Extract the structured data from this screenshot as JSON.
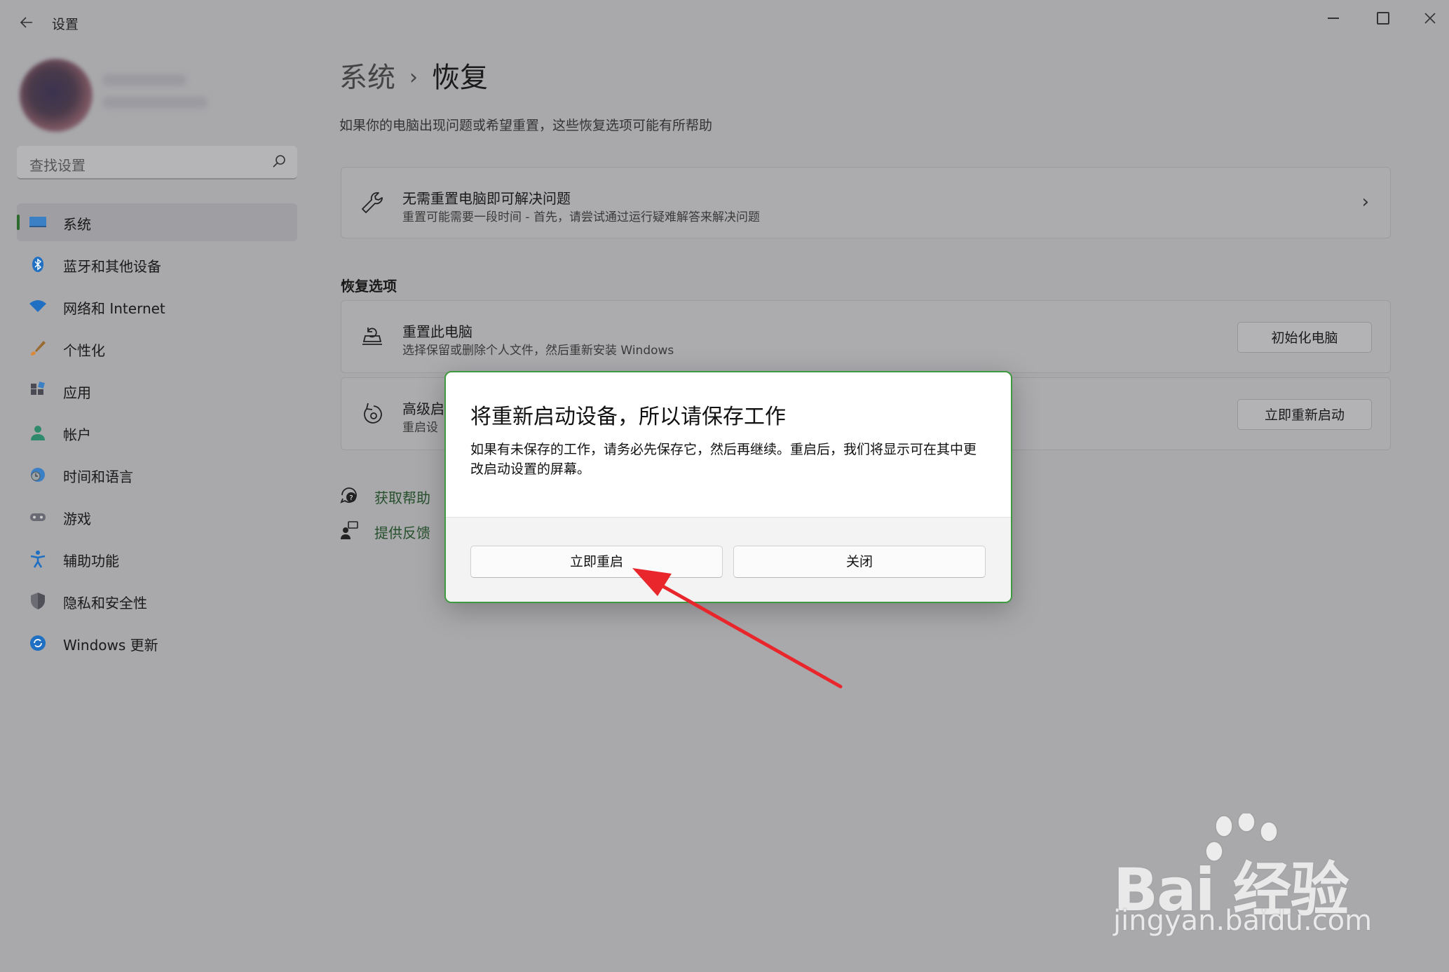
{
  "app": {
    "title": "设置",
    "back_icon": "back-arrow-icon"
  },
  "window_controls": [
    "minimize",
    "maximize",
    "close"
  ],
  "search": {
    "placeholder": "查找设置"
  },
  "nav": [
    {
      "label": "系统",
      "icon": "monitor-icon",
      "active": true
    },
    {
      "label": "蓝牙和其他设备",
      "icon": "bluetooth-icon"
    },
    {
      "label": "网络和 Internet",
      "icon": "wifi-icon"
    },
    {
      "label": "个性化",
      "icon": "brush-icon"
    },
    {
      "label": "应用",
      "icon": "apps-icon"
    },
    {
      "label": "帐户",
      "icon": "person-icon"
    },
    {
      "label": "时间和语言",
      "icon": "globe-clock-icon"
    },
    {
      "label": "游戏",
      "icon": "gamepad-icon"
    },
    {
      "label": "辅助功能",
      "icon": "accessibility-icon"
    },
    {
      "label": "隐私和安全性",
      "icon": "shield-icon"
    },
    {
      "label": "Windows 更新",
      "icon": "update-icon"
    }
  ],
  "breadcrumb": {
    "parent": "系统",
    "separator": "›",
    "current": "恢复"
  },
  "subtitle": "如果你的电脑出现问题或希望重置，这些恢复选项可能有所帮助",
  "troubleshoot_card": {
    "title": "无需重置电脑即可解决问题",
    "description": "重置可能需要一段时间 - 首先，请尝试通过运行疑难解答来解决问题"
  },
  "section_title": "恢复选项",
  "reset_card": {
    "title": "重置此电脑",
    "description": "选择保留或删除个人文件，然后重新安装 Windows",
    "button": "初始化电脑"
  },
  "advanced_card": {
    "title": "高级启",
    "description": "重启设",
    "button": "立即重新启动"
  },
  "help_links": [
    {
      "label": "获取帮助",
      "icon": "help-icon"
    },
    {
      "label": "提供反馈",
      "icon": "feedback-icon"
    }
  ],
  "dialog": {
    "title": "将重新启动设备，所以请保存工作",
    "body": "如果有未保存的工作，请务必先保存它，然后再继续。重启后，我们将显示可在其中更改启动设置的屏幕。",
    "primary_button": "立即重启",
    "secondary_button": "关闭"
  },
  "watermark": {
    "brand": "Bai  经验",
    "url": "jingyan.baidu.com"
  },
  "colors": {
    "accent": "#2d6a2d",
    "dialog_border": "#3e9a3e",
    "annotation_arrow": "#e8262b"
  }
}
